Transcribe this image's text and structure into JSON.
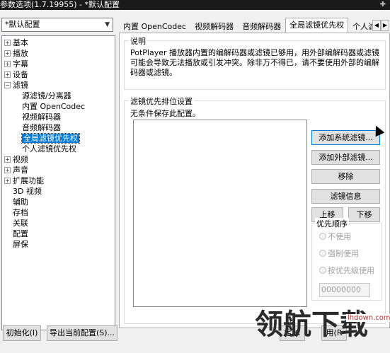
{
  "window": {
    "title": "参数选项(1.7.19955) - *默认配置",
    "pin_icon": "pin-icon"
  },
  "profile": {
    "selected": "*默认配置"
  },
  "tree": {
    "items": [
      {
        "label": "基本",
        "expand": "+",
        "child": false
      },
      {
        "label": "播放",
        "expand": "+",
        "child": false
      },
      {
        "label": "字幕",
        "expand": "+",
        "child": false
      },
      {
        "label": "设备",
        "expand": "+",
        "child": false
      },
      {
        "label": "滤镜",
        "expand": "-",
        "child": false
      },
      {
        "label": "源滤镜/分离器",
        "expand": "",
        "child": true
      },
      {
        "label": "内置 OpenCodec",
        "expand": "",
        "child": true
      },
      {
        "label": "视频解码器",
        "expand": "",
        "child": true
      },
      {
        "label": "音频解码器",
        "expand": "",
        "child": true
      },
      {
        "label": "全局滤镜优先权",
        "expand": "",
        "child": true,
        "selected": true
      },
      {
        "label": "个人滤镜优先权",
        "expand": "",
        "child": true
      },
      {
        "label": "视频",
        "expand": "+",
        "child": false
      },
      {
        "label": "声音",
        "expand": "+",
        "child": false
      },
      {
        "label": "扩展功能",
        "expand": "+",
        "child": false
      },
      {
        "label": "3D 视频",
        "expand": "",
        "child": false
      },
      {
        "label": "辅助",
        "expand": "",
        "child": false
      },
      {
        "label": "存档",
        "expand": "",
        "child": false
      },
      {
        "label": "关联",
        "expand": "",
        "child": false
      },
      {
        "label": "配置",
        "expand": "",
        "child": false
      },
      {
        "label": "屏保",
        "expand": "",
        "child": false
      }
    ]
  },
  "tabs": [
    {
      "label": "内置 OpenCodec",
      "active": false
    },
    {
      "label": "视频解码器",
      "active": false
    },
    {
      "label": "音频解码器",
      "active": false
    },
    {
      "label": "全局滤镜优先权",
      "active": true
    },
    {
      "label": "个人滤镜",
      "active": false
    }
  ],
  "description": {
    "title": "说明",
    "text": "PotPlayer 播放器内置的编解码器或滤镜已够用，用外部编解码器或滤镜可能会导致无法播放或引发冲突。除非万不得已，请不要使用外部的编解码器或滤镜。"
  },
  "filter_order": {
    "title": "滤镜优先排位设置",
    "status": "无条件保存此配置。",
    "buttons": {
      "add_system": "添加系统滤镜...",
      "add_external": "添加外部滤镜...",
      "remove": "移除",
      "info": "滤镜信息",
      "up": "上移",
      "down": "下移"
    },
    "priority": {
      "title": "优先顺序",
      "options": [
        "不使用",
        "强制使用",
        "按优先级使用"
      ],
      "value": "00000000"
    }
  },
  "bottom": {
    "init": "初始化(I)",
    "export": "导出当前配置(S)...",
    "ok_partial": "定(C",
    "apply_partial": "用(R"
  },
  "watermark": {
    "text": "领航下载",
    "url": "lhdown.com"
  }
}
